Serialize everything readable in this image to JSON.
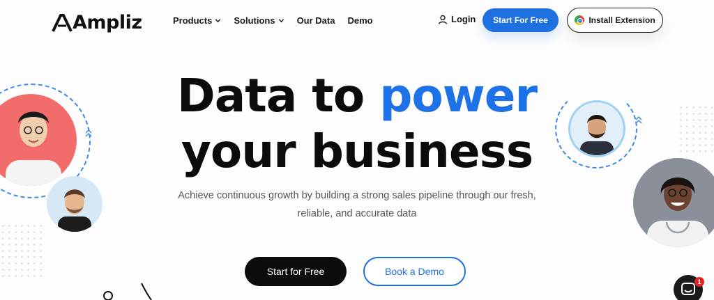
{
  "header": {
    "logo": "Ampliz",
    "nav": [
      {
        "label": "Products",
        "has_dropdown": true
      },
      {
        "label": "Solutions",
        "has_dropdown": true
      },
      {
        "label": "Our Data",
        "has_dropdown": false
      },
      {
        "label": "Demo",
        "has_dropdown": false
      }
    ],
    "login": "Login",
    "start_free": "Start For Free",
    "install_extension": "Install Extension"
  },
  "hero": {
    "headline_part1": "Data to ",
    "headline_highlight": "power",
    "headline_line2": "your business",
    "sub_line1": "Achieve continuous growth by building a strong sales pipeline through our fresh,",
    "sub_line2": "reliable, and accurate data",
    "cta_primary": "Start for Free",
    "cta_secondary": "Book a Demo"
  },
  "chat": {
    "badge_count": "1"
  },
  "colors": {
    "accent": "#1e6fe0",
    "headline_blue": "#1e72e8",
    "dark": "#0c0c0c"
  },
  "icons": [
    "ampliz-logo-icon",
    "chevron-down-icon",
    "user-icon",
    "chrome-icon",
    "double-chevron-up-icon",
    "chat-icon"
  ]
}
